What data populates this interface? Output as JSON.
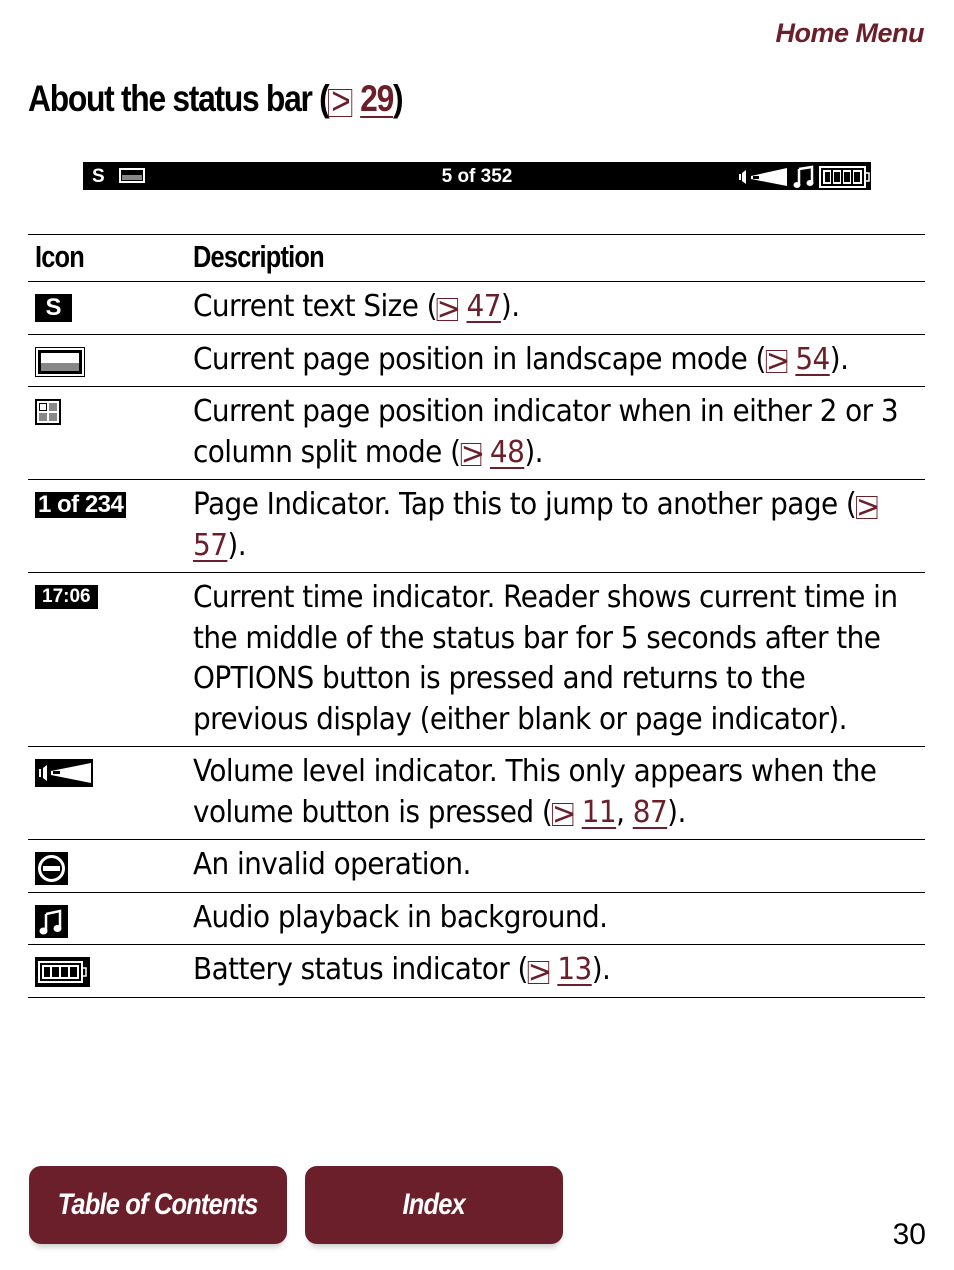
{
  "header": {
    "section_link": "Home Menu"
  },
  "title": {
    "text": "About the status bar (",
    "ref": "29",
    "close": ")"
  },
  "statusbar": {
    "size_letter": "S",
    "page_indicator": "5 of 352",
    "icons": [
      "text-size-icon",
      "landscape-position-icon",
      "volume-icon",
      "music-note-icon",
      "battery-icon"
    ]
  },
  "table": {
    "headers": {
      "icon": "Icon",
      "description": "Description"
    },
    "rows": [
      {
        "icon": "text-size-icon",
        "icon_text": "S",
        "pre": "Current text Size (",
        "refs": [
          "47"
        ],
        "post": ")."
      },
      {
        "icon": "landscape-position-icon",
        "pre": "Current page position in landscape mode (",
        "refs": [
          "54"
        ],
        "post": ")."
      },
      {
        "icon": "column-split-position-icon",
        "pre": "Current page position indicator when in either 2 or 3 column split mode (",
        "refs": [
          "48"
        ],
        "post": ")."
      },
      {
        "icon": "page-indicator-icon",
        "icon_text": "1 of 234",
        "pre": "Page Indicator. Tap this to jump to another page (",
        "refs": [
          "57"
        ],
        "post": ")."
      },
      {
        "icon": "time-indicator-icon",
        "icon_text": "17:06",
        "pre": "Current time indicator. Reader shows current time in the middle of the status bar for 5 seconds after the OPTIONS button is pressed and returns to the previous display (either blank or page indicator).",
        "refs": [],
        "post": ""
      },
      {
        "icon": "volume-icon",
        "pre": "Volume level indicator. This only appears when the volume button is pressed (",
        "refs": [
          "11",
          "87"
        ],
        "post": ")."
      },
      {
        "icon": "invalid-operation-icon",
        "pre": "An invalid operation.",
        "refs": [],
        "post": ""
      },
      {
        "icon": "music-note-icon",
        "pre": "Audio playback in background.",
        "refs": [],
        "post": ""
      },
      {
        "icon": "battery-icon",
        "pre": "Battery status indicator (",
        "refs": [
          "13"
        ],
        "post": ")."
      }
    ]
  },
  "footer": {
    "toc_label": "Table of Contents",
    "index_label": "Index",
    "page_number": "30"
  },
  "colors": {
    "accent": "#6b1f2a"
  }
}
